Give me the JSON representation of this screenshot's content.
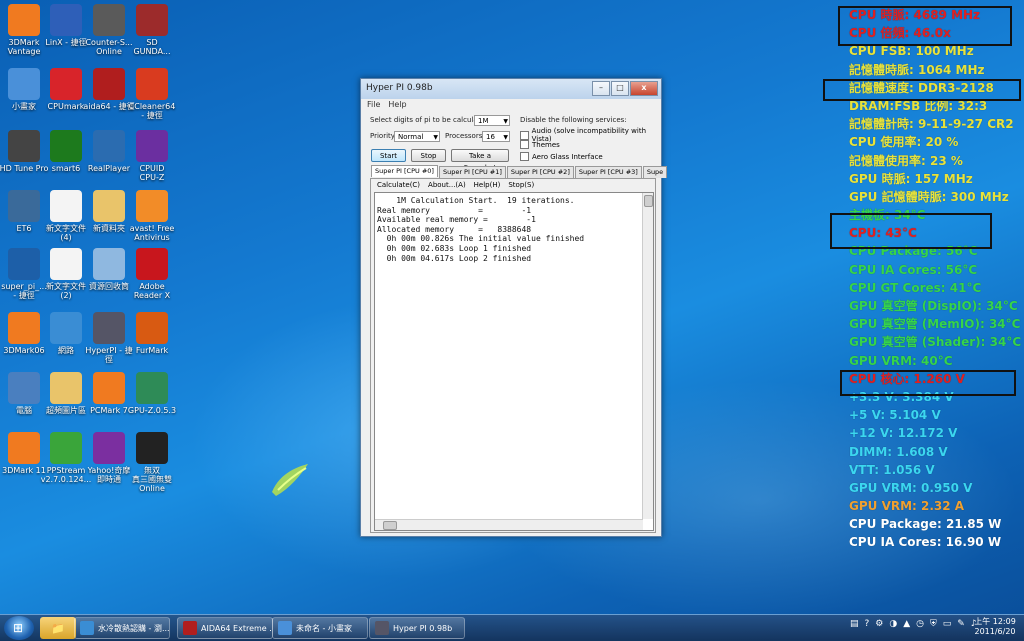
{
  "desktop_icons": [
    {
      "label": "3DMark\nVantage",
      "icon": "3dmark-vantage-icon",
      "color": "#f07a20"
    },
    {
      "label": "LinX - 捷徑",
      "icon": "linx-icon",
      "color": "#2e5fb8"
    },
    {
      "label": "Counter-S...\nOnline",
      "icon": "counter-strike-icon",
      "color": "#5a5a5a"
    },
    {
      "label": "SD\nGUNDA...",
      "icon": "sd-gundam-icon",
      "color": "#9c2b2b"
    },
    {
      "label": "小畫家",
      "icon": "paint-icon",
      "color": "#4a90d9"
    },
    {
      "label": "CPUmark",
      "icon": "cpumark-icon",
      "color": "#d8242a"
    },
    {
      "label": "aida64 - 捷徑",
      "icon": "aida64-icon",
      "color": "#b01e1e"
    },
    {
      "label": "CCleaner64\n- 捷徑",
      "icon": "ccleaner-icon",
      "color": "#d93b1f"
    },
    {
      "label": "HD Tune Pro",
      "icon": "hdtune-icon",
      "color": "#444"
    },
    {
      "label": "smart6",
      "icon": "smart6-icon",
      "color": "#1d7a1d"
    },
    {
      "label": "RealPlayer",
      "icon": "realplayer-icon",
      "color": "#2b6cb0"
    },
    {
      "label": "CPUID\nCPU-Z",
      "icon": "cpuz-icon",
      "color": "#6b2fa0"
    },
    {
      "label": "ET6",
      "icon": "et6-icon",
      "color": "#3a6a9a"
    },
    {
      "label": "新文字文件\n(4)",
      "icon": "text-file-icon",
      "color": "#f4f4f4"
    },
    {
      "label": "新資料夾",
      "icon": "folder-icon",
      "color": "#e9c46a"
    },
    {
      "label": "avast! Free\nAntivirus",
      "icon": "avast-icon",
      "color": "#f28c28"
    },
    {
      "label": "super_pi_...\n- 捷徑",
      "icon": "super-pi-icon",
      "color": "#1d5fa8"
    },
    {
      "label": "新文字文件\n(2)",
      "icon": "text-file-icon",
      "color": "#f4f4f4"
    },
    {
      "label": "資源回收筒",
      "icon": "recycle-bin-icon",
      "color": "#8fb8e0"
    },
    {
      "label": "Adobe\nReader X",
      "icon": "adobe-reader-icon",
      "color": "#c8161d"
    },
    {
      "label": "3DMark06",
      "icon": "3dmark06-icon",
      "color": "#f07a20"
    },
    {
      "label": "網路",
      "icon": "network-icon",
      "color": "#3a8dd4"
    },
    {
      "label": "HyperPI - 捷\n徑",
      "icon": "hyperpi-icon",
      "color": "#556"
    },
    {
      "label": "FurMark",
      "icon": "furmark-icon",
      "color": "#d85a12"
    },
    {
      "label": "電腦",
      "icon": "computer-icon",
      "color": "#4a7fbf"
    },
    {
      "label": "超頻圖片區",
      "icon": "folder-icon",
      "color": "#e9c46a"
    },
    {
      "label": "PCMark 7",
      "icon": "pcmark7-icon",
      "color": "#f07a20"
    },
    {
      "label": "GPU-Z.0.5.3",
      "icon": "gpuz-icon",
      "color": "#2e8b57"
    },
    {
      "label": "3DMark 11",
      "icon": "3dmark11-icon",
      "color": "#f07a20"
    },
    {
      "label": "PPStream\nv2.7.0.124...",
      "icon": "ppstream-icon",
      "color": "#3aa53a"
    },
    {
      "label": "Yahoo!奇摩\n即時通",
      "icon": "yahoo-messenger-icon",
      "color": "#7b2fa0"
    },
    {
      "label": "無双\n真三國無雙\nOnline",
      "icon": "sangoku-icon",
      "color": "#222"
    }
  ],
  "overlay": {
    "lines": [
      {
        "text": "CPU 時脈: 4689 MHz",
        "color": "#e02020"
      },
      {
        "text": "CPU 倍頻: 46.0x",
        "color": "#e02020"
      },
      {
        "text": "CPU FSB: 100 MHz",
        "color": "#e8e23a"
      },
      {
        "text": "記憶體時脈: 1064 MHz",
        "color": "#e8e23a"
      },
      {
        "text": "記憶體速度: DDR3-2128",
        "color": "#e8e23a"
      },
      {
        "text": "DRAM:FSB 比例: 32:3",
        "color": "#e8e23a"
      },
      {
        "text": "記憶體計時: 9-11-9-27 CR2",
        "color": "#e8e23a"
      },
      {
        "text": "CPU 使用率: 20 %",
        "color": "#e8e23a"
      },
      {
        "text": "記憶體使用率: 23 %",
        "color": "#e8e23a"
      },
      {
        "text": "GPU 時脈: 157 MHz",
        "color": "#e8e23a"
      },
      {
        "text": "GPU 記憶體時脈: 300 MHz",
        "color": "#e8e23a"
      },
      {
        "text": "主機板: 34°C",
        "color": "#36d44a"
      },
      {
        "text": "CPU: 43°C",
        "color": "#e02020"
      },
      {
        "text": "CPU Package: 56°C",
        "color": "#36d44a"
      },
      {
        "text": "CPU IA Cores: 56°C",
        "color": "#36d44a"
      },
      {
        "text": "CPU GT Cores: 41°C",
        "color": "#36d44a"
      },
      {
        "text": "GPU 真空管 (DispIO): 34°C",
        "color": "#36d44a"
      },
      {
        "text": "GPU 真空管 (MemIO): 34°C",
        "color": "#36d44a"
      },
      {
        "text": "GPU 真空管 (Shader): 34°C",
        "color": "#36d44a"
      },
      {
        "text": "GPU VRM: 40°C",
        "color": "#36d44a"
      },
      {
        "text": "CPU 核心: 1.260 V",
        "color": "#e02020"
      },
      {
        "text": "+3.3 V: 3.384 V",
        "color": "#3bd7f0"
      },
      {
        "text": "+5 V: 5.104 V",
        "color": "#3bd7f0"
      },
      {
        "text": "+12 V: 12.172 V",
        "color": "#3bd7f0"
      },
      {
        "text": "DIMM: 1.608 V",
        "color": "#3bd7f0"
      },
      {
        "text": "VTT: 1.056 V",
        "color": "#3bd7f0"
      },
      {
        "text": "GPU VRM: 0.950 V",
        "color": "#3bd7f0"
      },
      {
        "text": "GPU VRM: 2.32 A",
        "color": "#f0a030"
      },
      {
        "text": "CPU Package: 21.85 W",
        "color": "#ffffff"
      },
      {
        "text": "CPU IA Cores: 16.90 W",
        "color": "#ffffff"
      }
    ]
  },
  "hyperpi": {
    "title": "Hyper PI 0.98b",
    "menu": [
      "File",
      "Help"
    ],
    "digits_label": "Select digits of pi to be calculated:",
    "digits_value": "1M",
    "priority_label": "Priority:",
    "priority_value": "Normal",
    "processors_label": "Processors:",
    "processors_value": "16",
    "start_label": "Start",
    "stop_label": "Stop",
    "snapshot_label": "Take a Snapshot",
    "disable_label": "Disable the following services:",
    "checkbox_audio": "Audio (solve incompatibility with Vista)",
    "checkbox_themes": "Themes",
    "checkbox_aero": "Aero Glass Interface",
    "tabs": [
      "Super PI [CPU #0]",
      "Super PI [CPU #1]",
      "Super PI [CPU #2]",
      "Super PI [CPU #3]",
      "Supe"
    ],
    "inner_menu": [
      "Calculate(C)",
      "About...(A)",
      "Help(H)",
      "Stop(S)"
    ],
    "output": "    1M Calculation Start.  19 iterations.\nReal memory          =        -1\nAvailable real memory =        -1\nAllocated memory     =   8388648\n  0h 00m 00.826s The initial value finished\n  0h 00m 02.683s Loop 1 finished\n  0h 00m 04.617s Loop 2 finished"
  },
  "taskbar": {
    "buttons": [
      {
        "label": "水冷散熱認購 - 瀏...",
        "icon": "ie-icon",
        "color": "#3a8dd4"
      },
      {
        "label": "AIDA64 Extreme ...",
        "icon": "aida64-icon",
        "color": "#b01e1e"
      },
      {
        "label": "未命名 - 小畫家",
        "icon": "paint-icon",
        "color": "#4a90d9"
      },
      {
        "label": "Hyper PI 0.98b",
        "icon": "hyperpi-icon",
        "color": "#556"
      }
    ],
    "clock_time": "上午 12:09",
    "clock_date": "2011/6/20"
  },
  "glyphs": {
    "folder": "📁",
    "ie": "e",
    "media": "▶",
    "min": "–",
    "max": "□",
    "close": "x",
    "arrow": "▼",
    "start": "⊞",
    "tray": [
      "▤",
      "?",
      "⚙",
      "◑",
      "▲",
      "◷",
      "⛨",
      "▭",
      "✎",
      "♪"
    ]
  }
}
